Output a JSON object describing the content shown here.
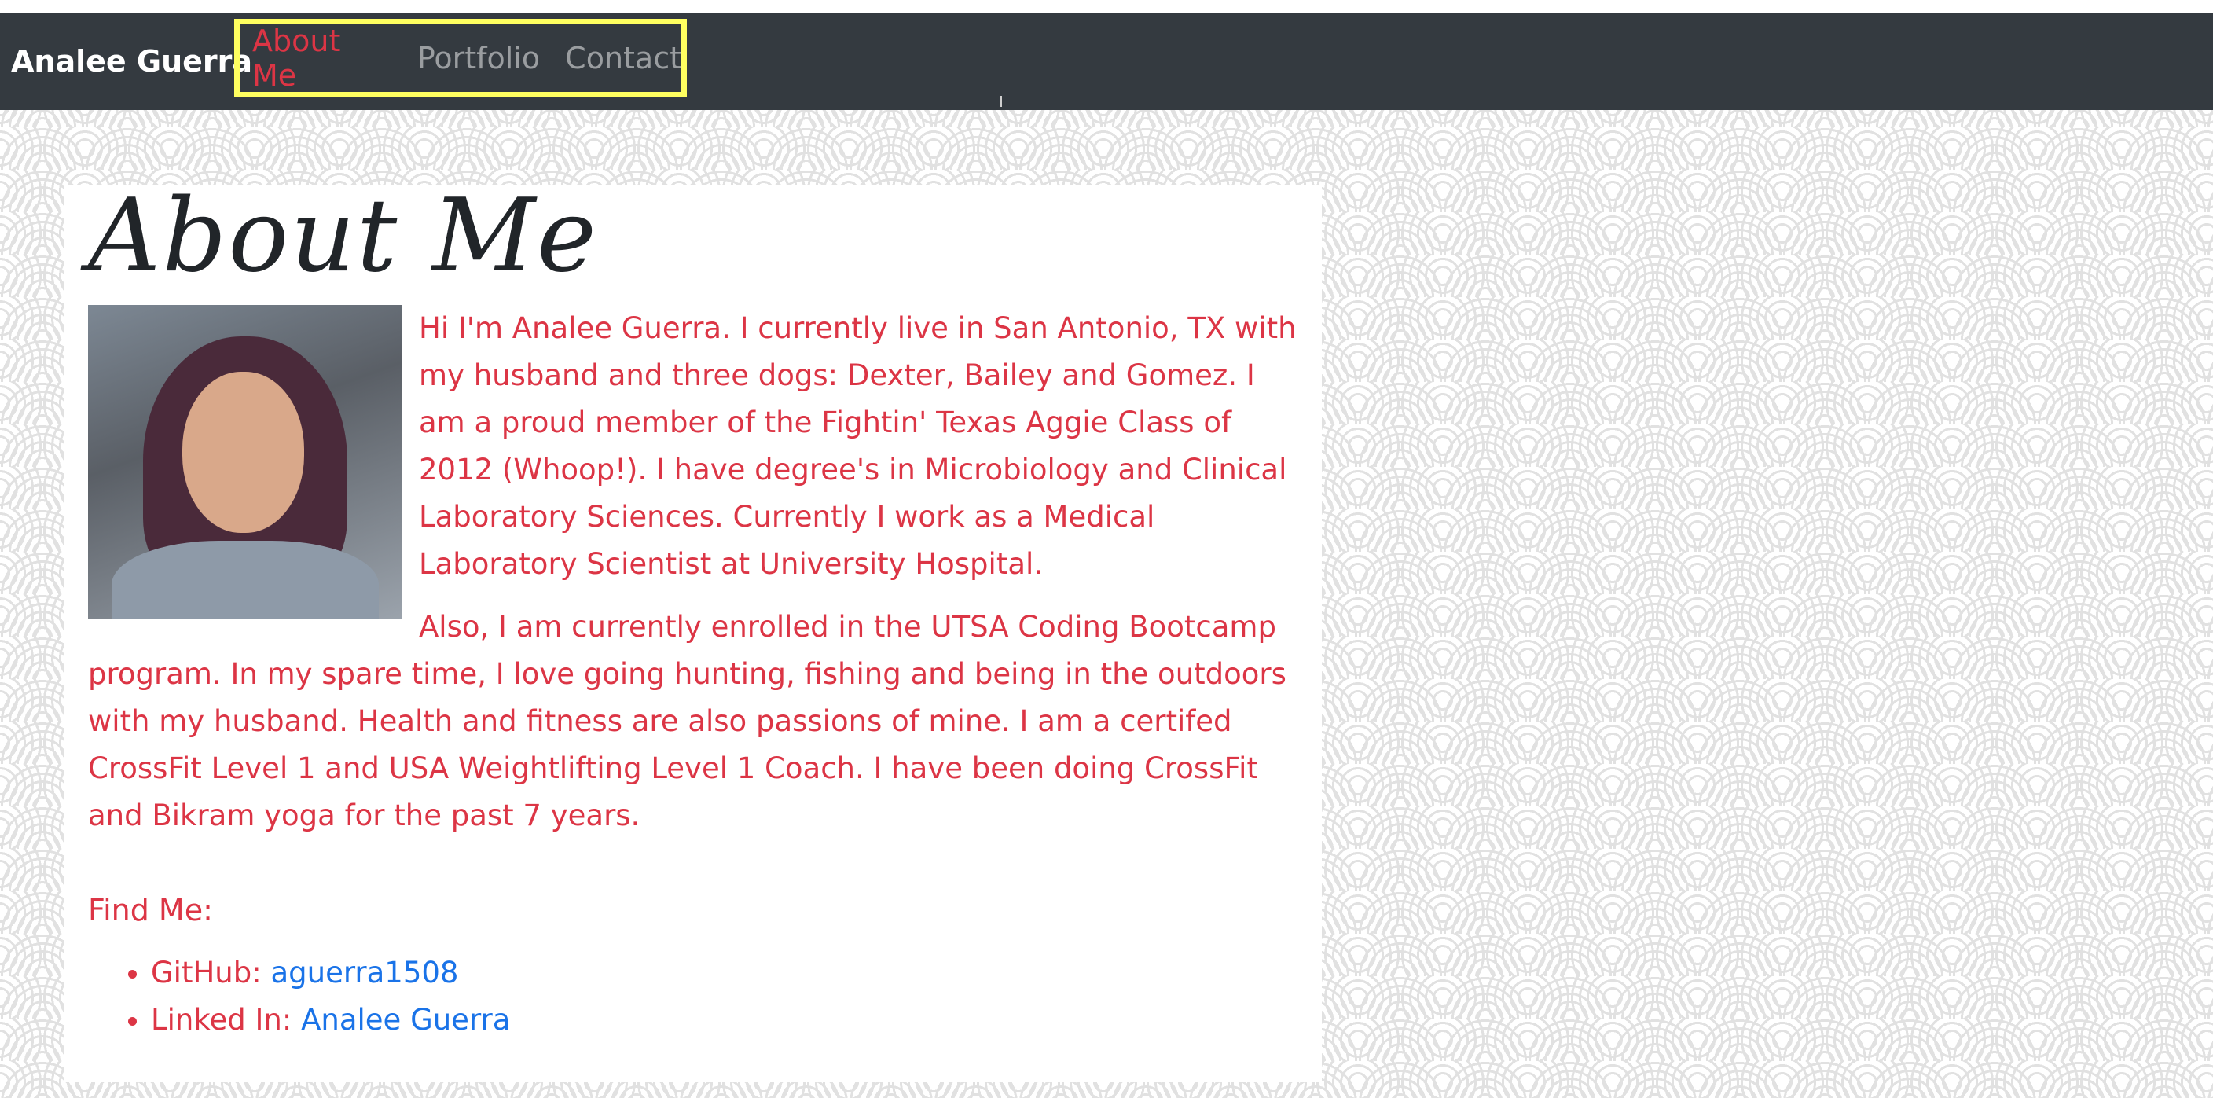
{
  "navbar": {
    "brand": "Analee Guerra",
    "links": [
      {
        "label": "About Me",
        "active": true
      },
      {
        "label": "Portfolio",
        "active": false
      },
      {
        "label": "Contact",
        "active": false
      }
    ]
  },
  "main": {
    "title": "About Me",
    "paragraphs": [
      "Hi I'm Analee Guerra. I currently live in San Antonio, TX with my husband and three dogs: Dexter, Bailey and Gomez. I am a proud member of the Fightin' Texas Aggie Class of 2012 (Whoop!). I have degree's in Microbiology and Clinical Laboratory Sciences. Currently I work as a Medical Laboratory Scientist at University Hospital.",
      "Also, I am currently enrolled in the UTSA Coding Bootcamp program. In my spare time, I love going hunting, fishing and being in the outdoors with my husband. Health and fitness are also passions of mine. I am a certifed CrossFit Level 1 and USA Weightlifting Level 1 Coach. I have been doing CrossFit and Bikram yoga for the past 7 years."
    ],
    "find_me": {
      "heading": "Find Me:",
      "items": [
        {
          "label": "GitHub:",
          "link_text": "aguerra1508"
        },
        {
          "label": "Linked In:",
          "link_text": "Analee Guerra"
        }
      ]
    }
  },
  "colors": {
    "navbar_bg": "#343a40",
    "accent_red": "#dc3545",
    "link_blue": "#1a73e8",
    "highlight_box": "#ffff60"
  }
}
